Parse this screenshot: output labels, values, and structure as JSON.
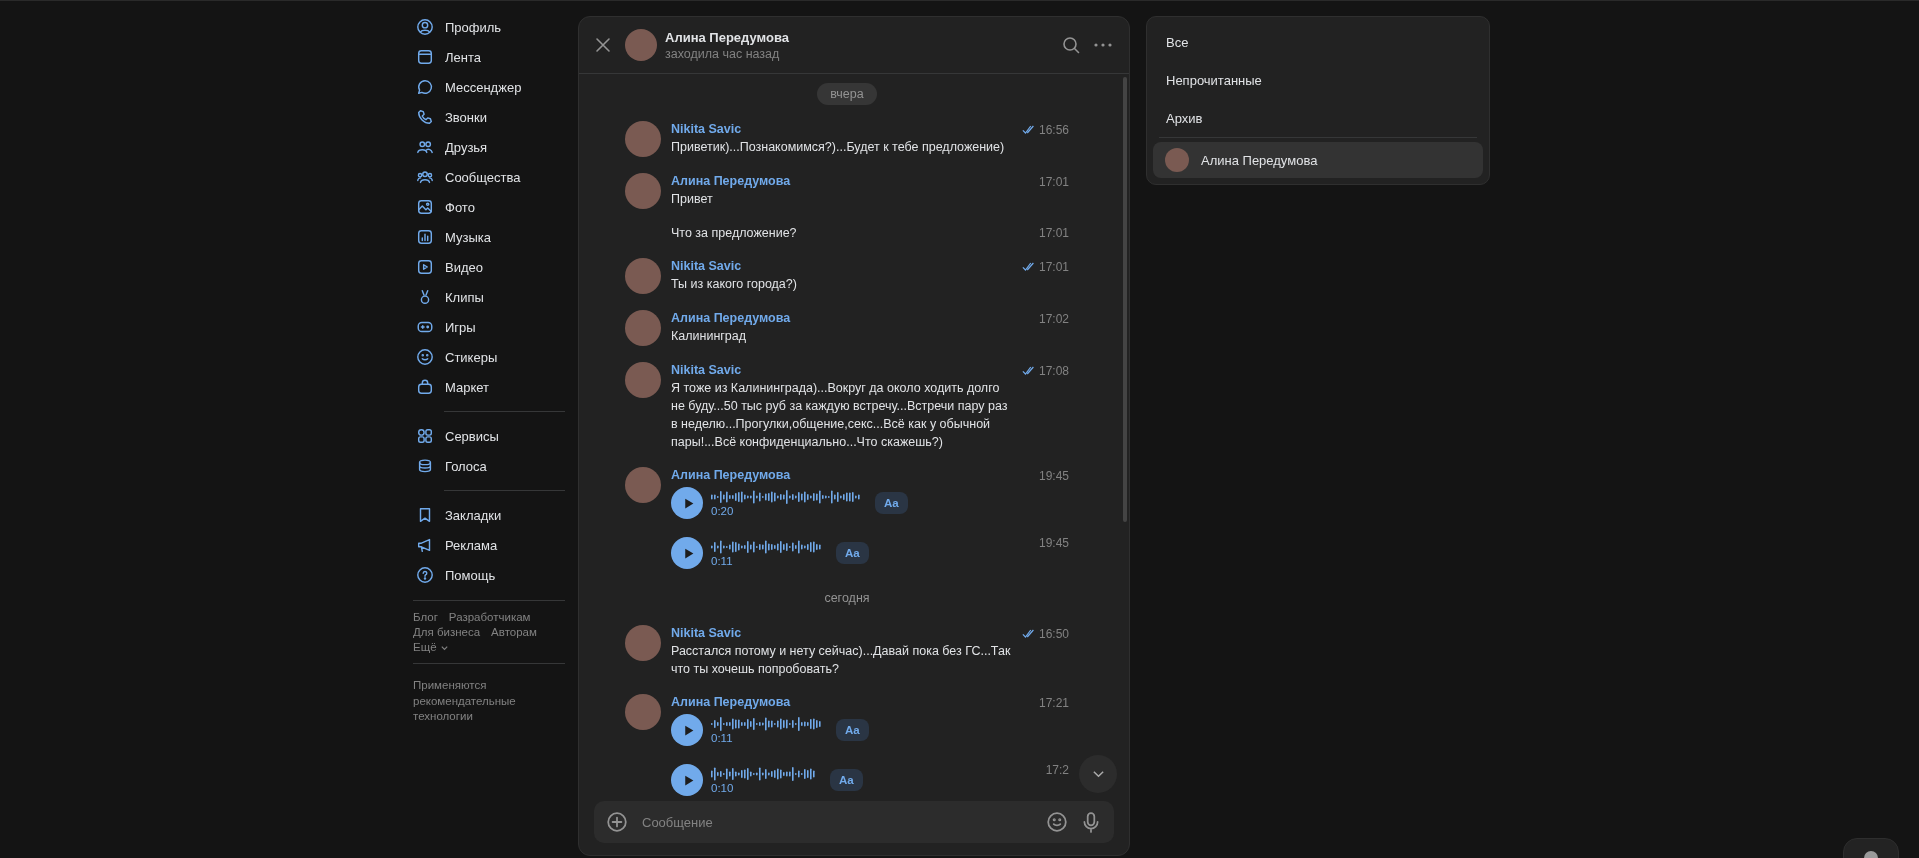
{
  "sidebar": {
    "groups": [
      [
        {
          "label": "Профиль"
        },
        {
          "label": "Лента"
        },
        {
          "label": "Мессенджер"
        },
        {
          "label": "Звонки"
        },
        {
          "label": "Друзья"
        },
        {
          "label": "Сообщества"
        },
        {
          "label": "Фото"
        },
        {
          "label": "Музыка"
        },
        {
          "label": "Видео"
        },
        {
          "label": "Клипы"
        },
        {
          "label": "Игры"
        },
        {
          "label": "Стикеры"
        },
        {
          "label": "Маркет"
        }
      ],
      [
        {
          "label": "Сервисы"
        },
        {
          "label": "Голоса"
        }
      ],
      [
        {
          "label": "Закладки"
        },
        {
          "label": "Реклама"
        },
        {
          "label": "Помощь"
        }
      ]
    ],
    "footer_links": [
      "Блог",
      "Разработчикам",
      "Для бизнеса",
      "Авторам"
    ],
    "more_link": "Ещё",
    "note": "Применяются рекомендательные технологии"
  },
  "chat": {
    "title": "Алина Передумова",
    "status": "заходила час назад",
    "messages": [
      {
        "kind": "date",
        "text": "вчера",
        "pill": true
      },
      {
        "kind": "text",
        "author": "Nikita Savic",
        "time": "16:56",
        "read": true,
        "text": "Приветик)...Познакомимся?)...Будет к тебе предложение)"
      },
      {
        "kind": "text",
        "author": "Алина Передумова",
        "time": "17:01",
        "read": false,
        "text": "Привет"
      },
      {
        "kind": "text",
        "time": "17:01",
        "read": false,
        "text": "Что за предложение?"
      },
      {
        "kind": "text",
        "author": "Nikita Savic",
        "time": "17:01",
        "read": true,
        "text": "Ты из какого города?)"
      },
      {
        "kind": "text",
        "author": "Алина Передумова",
        "time": "17:02",
        "read": false,
        "text": "Калининград"
      },
      {
        "kind": "text",
        "author": "Nikita Savic",
        "time": "17:08",
        "read": true,
        "text": "Я тоже из Калининграда)...Вокруг да около ходить долго не буду...50 тыс руб за каждую встречу...Встречи пару раз в неделю...Прогулки,общение,секс...Всё как у обычной пары!...Всё конфиденциально...Что скажешь?)"
      },
      {
        "kind": "voice",
        "author": "Алина Передумова",
        "time": "19:45",
        "read": false,
        "duration": "0:20",
        "transcribe": "Aa"
      },
      {
        "kind": "voice",
        "time": "19:45",
        "read": false,
        "duration": "0:11",
        "transcribe": "Aa"
      },
      {
        "kind": "date",
        "text": "сегодня",
        "pill": false
      },
      {
        "kind": "text",
        "author": "Nikita Savic",
        "time": "16:50",
        "read": true,
        "text": "Расстался потому и нету сейчас)...Давай пока без ГС...Так что ты хочешь попробовать?"
      },
      {
        "kind": "voice",
        "author": "Алина Передумова",
        "time": "17:21",
        "read": false,
        "duration": "0:11",
        "transcribe": "Aa"
      },
      {
        "kind": "voice",
        "time": "17:2",
        "read": false,
        "duration": "0:10",
        "transcribe": "Aa"
      }
    ],
    "input": {
      "placeholder": "Сообщение"
    }
  },
  "folders": {
    "items": [
      {
        "label": "Все"
      },
      {
        "label": "Непрочитанные"
      },
      {
        "label": "Архив"
      }
    ],
    "chats": [
      {
        "name": "Алина Передумова",
        "selected": true
      }
    ]
  }
}
